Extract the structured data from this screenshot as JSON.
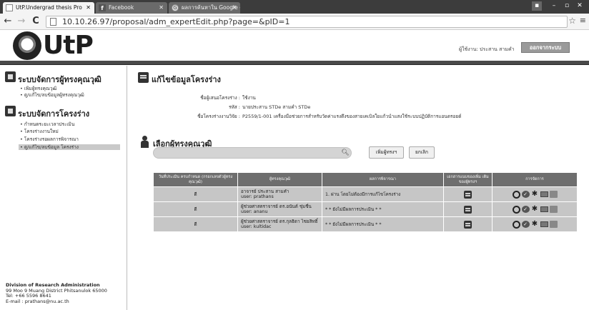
{
  "browser": {
    "tabs": [
      {
        "label": "UtP.Undergrad thesis Pro",
        "active": true
      },
      {
        "label": "Facebook",
        "active": false
      },
      {
        "label": "ผลการค้นหาใน Google - ค้นหา",
        "active": false
      }
    ],
    "url": "10.10.26.97/proposal/adm_expertEdit.php?page=&pID=1"
  },
  "header": {
    "logo_text": "UtP",
    "user_label": "ผู้ใช้งาน: ประสาน สามคำ",
    "logout_label": "ออกจากระบบ"
  },
  "sidebar": {
    "sections": [
      {
        "title": "ระบบจัดการผู้ทรงคุณวุฒิ",
        "items": [
          {
            "label": "• เพิ่มผู้ทรงคุณวุฒิ",
            "active": false
          },
          {
            "label": "• ดู/แก้ไข/ลบข้อมูลผู้ทรงคุณวุฒิ",
            "active": false
          }
        ]
      },
      {
        "title": "ระบบจัดการโครงร่าง",
        "items": [
          {
            "label": "• กำหนดระยะเวลาประเมิน",
            "active": false
          },
          {
            "label": "• โครงร่างงานใหม่",
            "active": false
          },
          {
            "label": "• โครงร่างรอผลการพิจารณา",
            "active": false
          },
          {
            "label": "• ดู/แก้ไข/ลบข้อมูล โครงร่าง",
            "active": true
          }
        ]
      }
    ],
    "footer": {
      "org": "Division of Research Administration",
      "address": "99 Moo 9 Muang District Phitsanulok 65000",
      "tel": "Tel: +66 5596 8641",
      "email": "E-mail : prathans@nu.ac.th"
    }
  },
  "main": {
    "title": "แก้ไขข้อมูลโครงร่าง",
    "fields": [
      {
        "label": "ชื่อผู้เสนอโครงร่าง :",
        "value": "ใช้งาน"
      },
      {
        "label": "รหัส :",
        "value": "นายประสาน STDe สามคำ STDe"
      },
      {
        "label": "ชื่อโครงร่างงานวิจัย :",
        "value": "P2559/1-001 เครื่องมือช่วยการสำหรับวัดค่าแรงดึงของสายเคเบิลใยแก้วนำแสงใช้ระบบปฏิบัติการแอนดรอยด์"
      }
    ],
    "select_title": "เลือกผู้ทรงคุณวุฒิ",
    "search": {
      "value": "",
      "placeholder": ""
    },
    "add_button": "เพิ่มผู้ทรงฯ",
    "cancel_button": "ยกเลิก"
  },
  "table": {
    "headers": [
      "วันที่ประเมิน ครบกำหนด (กรอกเลขตัวผู้ทรงคุณวุฒิ)",
      "ผู้ทรงคุณวุฒิ",
      "ผลการพิจารณา",
      "เอกสารแนบของเพิ่ม เติมของผู้ทรงฯ",
      "การจัดการ"
    ],
    "rows": [
      {
        "date": "ดี",
        "expert_name": "อาจารย์ ประสาน สามคำ",
        "expert_user": "user: prathans",
        "result": "1. ผ่าน โดยไม่ต้องมีการแก้ไขโครงร่าง"
      },
      {
        "date": "ดี",
        "expert_name": "ผู้ช่วยศาสตราจารย์ ดร.อนันต์ ชุ่มชื่น",
        "expert_user": "user: ananu",
        "result": "* * ยังไม่มีผลการประเมิน * *"
      },
      {
        "date": "ดี",
        "expert_name": "ผู้ช่วยศาสตราจารย์ ดร.กุลธิดา ไชยสิทธิ์",
        "expert_user": "user: kultidac",
        "result": "* * ยังไม่มีผลการประเมิน * *"
      }
    ]
  }
}
